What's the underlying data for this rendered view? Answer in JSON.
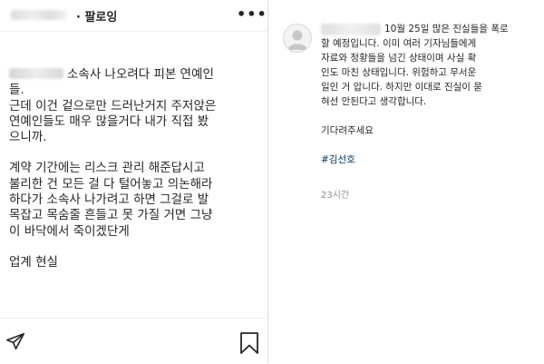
{
  "post": {
    "follow_label": "· 팔로잉",
    "more_icon": "more-horizontal-icon",
    "caption_lines": [
      "소속사 나오려다 피본 연예인",
      "들.",
      "근데 이건 겉으로만 드러난거지 주저앉은",
      "연예인들도 매우 많을거다 내가 직접 봤",
      "으니까.",
      "",
      "계약 기간에는 리스크 관리 해준답시고",
      "불리한 건 모든 걸 다 털어놓고 의논해라",
      "하다가 소속사 나가려고 하면 그걸로 발",
      "목잡고 목숨줄 흔들고 못 가질 거면 그냥",
      "이 바닥에서 죽이겠단게",
      "",
      "업계 현실"
    ],
    "actions": {
      "share_icon": "paper-plane-icon",
      "save_icon": "bookmark-icon"
    }
  },
  "comment": {
    "avatar_icon": "default-avatar-icon",
    "lines": [
      "10월 25일 많은 진실들을 폭로",
      "할 예정입니다. 이미 여러 기자님들에게",
      "자료와 정황들을 넘긴 상태이며 사실 확",
      "인도 마친 상태입니다. 위험하고 무서운",
      "일인 거 압니다. 하지만 이대로 진실이 묻",
      "혀선 안된다고 생각합니다."
    ],
    "closing": "기다려주세요",
    "hashtag": "#김선호",
    "time": "23시간"
  }
}
